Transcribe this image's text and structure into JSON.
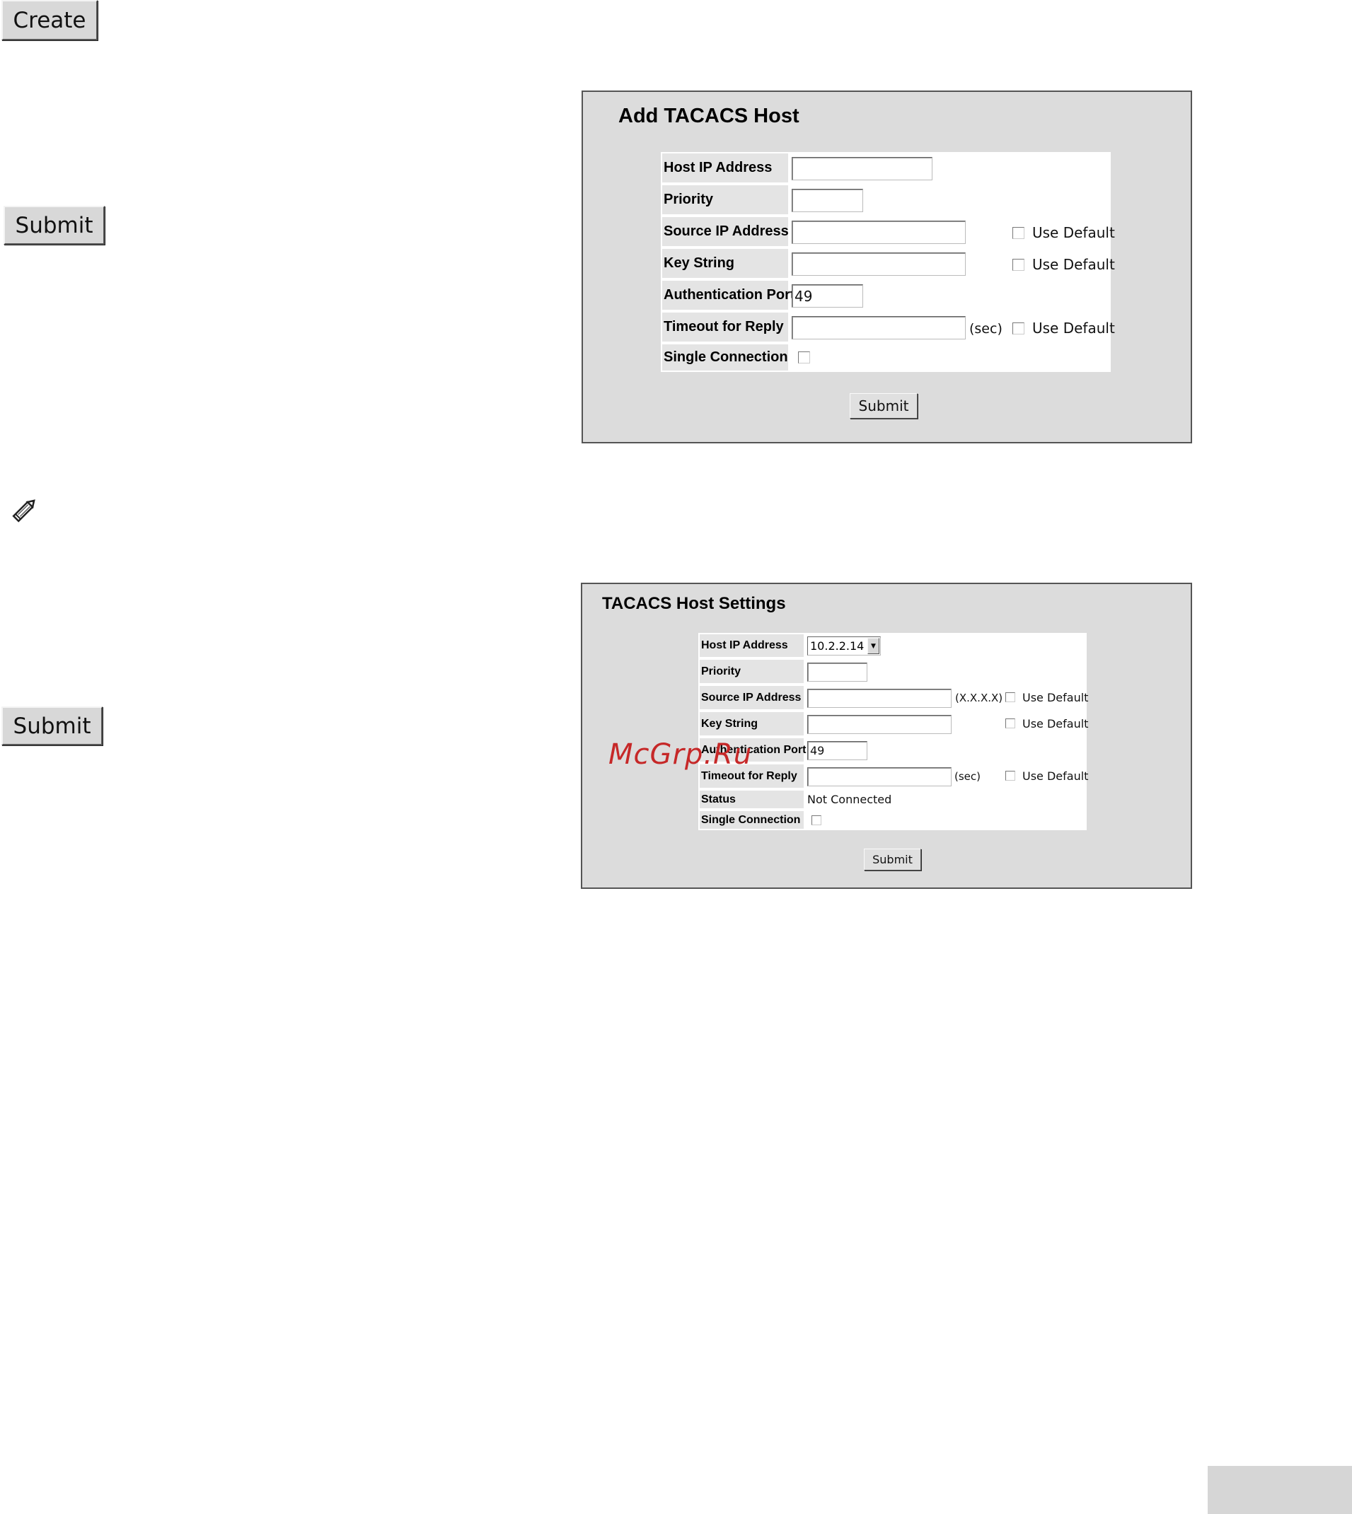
{
  "buttons": {
    "create_label": "Create",
    "submit_label_1": "Submit",
    "submit_label_2": "Submit"
  },
  "icons": {
    "edit": "pencil-icon"
  },
  "add_host": {
    "title": "Add TACACS Host",
    "labels": {
      "host_ip": "Host IP Address",
      "priority": "Priority",
      "source_ip": "Source IP Address",
      "key_string": "Key String",
      "auth_port": "Authentication Port",
      "timeout": "Timeout for Reply",
      "single_conn": "Single Connection"
    },
    "values": {
      "host_ip": "",
      "priority": "",
      "source_ip": "",
      "key_string": "",
      "auth_port": "49",
      "timeout": ""
    },
    "use_default": "Use Default",
    "sec_unit": "(sec)",
    "submit_label": "Submit"
  },
  "host_settings": {
    "title": "TACACS Host Settings",
    "labels": {
      "host_ip": "Host IP Address",
      "priority": "Priority",
      "source_ip": "Source IP Address",
      "key_string": "Key String",
      "auth_port": "Authentication Port",
      "timeout": "Timeout for Reply",
      "status": "Status",
      "single_conn": "Single Connection"
    },
    "values": {
      "host_ip_selected": "10.2.2.14",
      "priority": "",
      "source_ip": "",
      "key_string": "",
      "auth_port": "49",
      "timeout": "",
      "status": "Not Connected"
    },
    "ip_format_hint": "(X.X.X.X)",
    "use_default": "Use Default",
    "sec_unit": "(sec)",
    "submit_label": "Submit"
  },
  "watermark": "McGrp.Ru"
}
